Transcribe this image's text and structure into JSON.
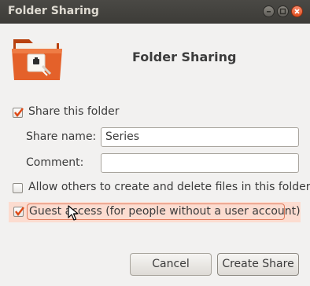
{
  "window": {
    "title": "Folder Sharing"
  },
  "header": {
    "title": "Folder Sharing",
    "icon": "shared-folder-icon"
  },
  "share_folder": {
    "label": "Share this folder",
    "checked": true
  },
  "share_name": {
    "label": "Share name:",
    "value": "Series"
  },
  "comment": {
    "label": "Comment:",
    "value": ""
  },
  "allow_others": {
    "label": "Allow others to create and delete files in this folder",
    "checked": false
  },
  "guest_access": {
    "label": "Guest access (for people without a user account)",
    "checked": true
  },
  "buttons": {
    "cancel": "Cancel",
    "create": "Create Share"
  },
  "colors": {
    "accent": "#dd4814",
    "titlebar": "#3d3c38",
    "highlight": "#fcdcd0"
  }
}
